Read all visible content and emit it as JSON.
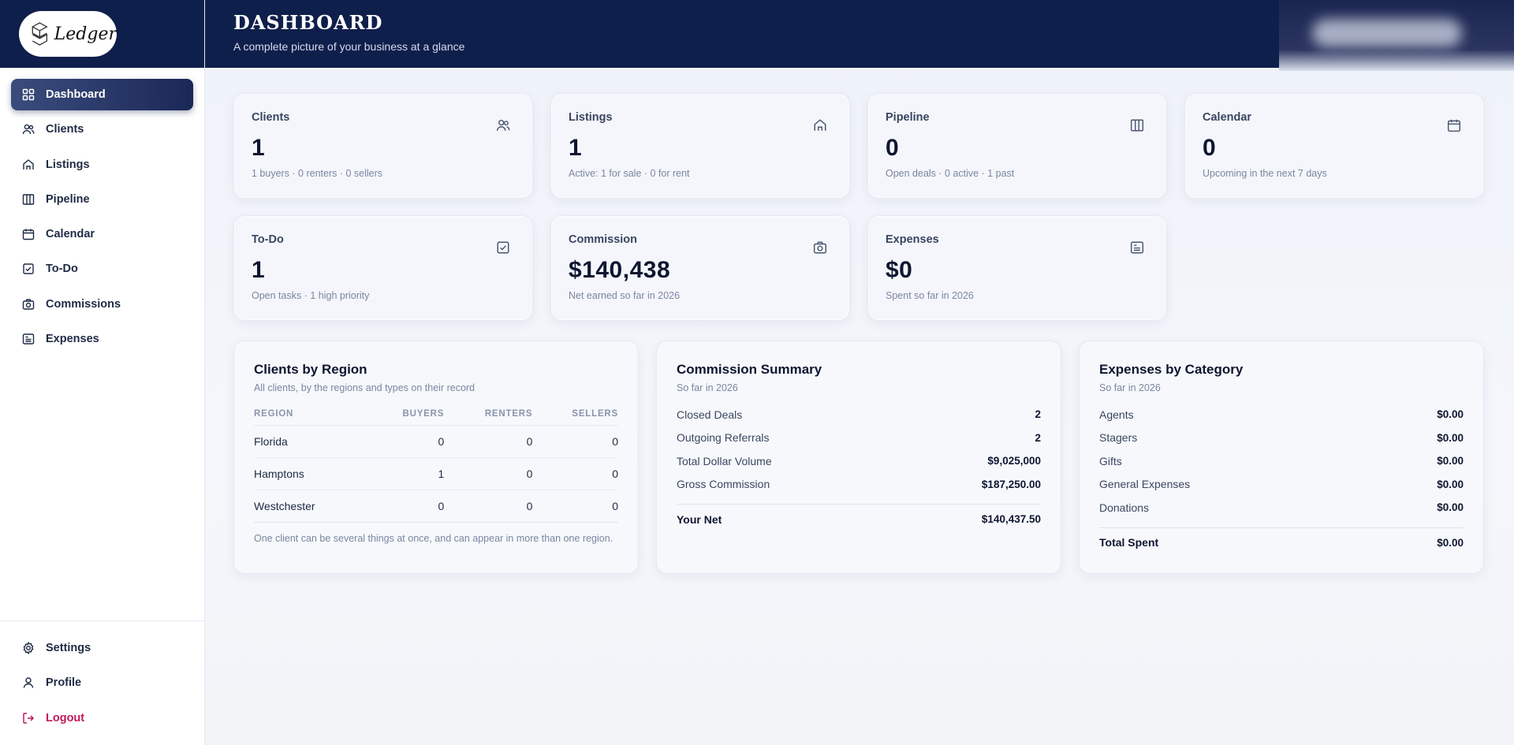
{
  "brand": {
    "logo_text": "Ledger"
  },
  "sidebar": {
    "items": [
      {
        "label": "Dashboard",
        "icon": "grid-icon"
      },
      {
        "label": "Clients",
        "icon": "users-icon"
      },
      {
        "label": "Listings",
        "icon": "house-icon"
      },
      {
        "label": "Pipeline",
        "icon": "columns-icon"
      },
      {
        "label": "Calendar",
        "icon": "calendar-icon"
      },
      {
        "label": "To-Do",
        "icon": "checkbox-icon"
      },
      {
        "label": "Commissions",
        "icon": "camera-icon"
      },
      {
        "label": "Expenses",
        "icon": "receipt-icon"
      }
    ],
    "bottom": [
      {
        "label": "Settings",
        "icon": "gear-icon"
      },
      {
        "label": "Profile",
        "icon": "user-icon"
      },
      {
        "label": "Logout",
        "icon": "logout-icon"
      }
    ]
  },
  "header": {
    "title": "DASHBOARD",
    "subtitle": "A complete picture of your business at a glance"
  },
  "stats": [
    {
      "label": "Clients",
      "value": "1",
      "note": "1 buyers · 0 renters · 0 sellers"
    },
    {
      "label": "Listings",
      "value": "1",
      "note": "Active: 1 for sale · 0 for rent"
    },
    {
      "label": "Pipeline",
      "value": "0",
      "note": "Open deals · 0 active · 1 past"
    },
    {
      "label": "Calendar",
      "value": "0",
      "note": "Upcoming in the next 7 days"
    },
    {
      "label": "To-Do",
      "value": "1",
      "note": "Open tasks · 1 high priority"
    },
    {
      "label": "Commission",
      "value": "$140,438",
      "note": "Net earned so far in 2026"
    },
    {
      "label": "Expenses",
      "value": "$0",
      "note": "Spent so far in 2026"
    }
  ],
  "region": {
    "title": "Clients by Region",
    "subtitle": "All clients, by the regions and types on their record",
    "columns": [
      "REGION",
      "BUYERS",
      "RENTERS",
      "SELLERS"
    ],
    "rows": [
      [
        "Florida",
        "0",
        "0",
        "0"
      ],
      [
        "Hamptons",
        "1",
        "0",
        "0"
      ],
      [
        "Westchester",
        "0",
        "0",
        "0"
      ]
    ],
    "note": "One client can be several things at once, and can appear in more than one region."
  },
  "commission": {
    "title": "Commission Summary",
    "subtitle": "So far in 2026",
    "rows": [
      {
        "label": "Closed Deals",
        "value": "2"
      },
      {
        "label": "Outgoing Referrals",
        "value": "2"
      },
      {
        "label": "Total Dollar Volume",
        "value": "$9,025,000"
      },
      {
        "label": "Gross Commission",
        "value": "$187,250.00"
      }
    ],
    "total": {
      "label": "Your Net",
      "value": "$140,437.50"
    }
  },
  "expenses": {
    "title": "Expenses by Category",
    "subtitle": "So far in 2026",
    "rows": [
      {
        "label": "Agents",
        "value": "$0.00"
      },
      {
        "label": "Stagers",
        "value": "$0.00"
      },
      {
        "label": "Gifts",
        "value": "$0.00"
      },
      {
        "label": "General Expenses",
        "value": "$0.00"
      },
      {
        "label": "Donations",
        "value": "$0.00"
      }
    ],
    "total": {
      "label": "Total Spent",
      "value": "$0.00"
    }
  }
}
